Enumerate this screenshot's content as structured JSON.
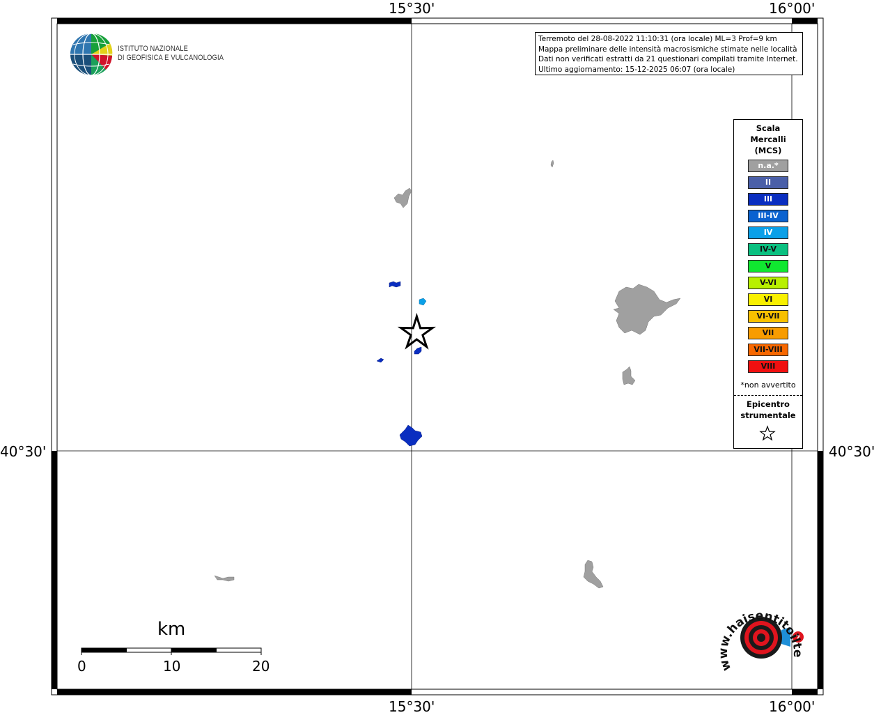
{
  "axes": {
    "top_labels": [
      "15°30'",
      "16°00'"
    ],
    "bottom_labels": [
      "15°30'",
      "16°00'"
    ],
    "left_labels": [
      "40°30'"
    ],
    "right_labels": [
      "40°30'"
    ]
  },
  "logo": {
    "line1": "ISTITUTO NAZIONALE",
    "line2": "DI GEOFISICA E VULCANOLOGIA",
    "icon": "globe-icon"
  },
  "info": {
    "line1": "Terremoto del 28-08-2022 11:10:31 (ora locale) ML=3 Prof=9 km",
    "line2": "Mappa preliminare delle intensità macrosismiche stimate nelle località",
    "line3": "Dati non verificati estratti da 21 questionari compilati tramite Internet.",
    "line4": "Ultimo aggiornamento: 15-12-2025 06:07 (ora locale)"
  },
  "legend": {
    "title_line1": "Scala",
    "title_line2": "Mercalli",
    "title_line3": "(MCS)",
    "items": [
      {
        "label": "n.a.*",
        "color": "#a0a0a0"
      },
      {
        "label": "II",
        "color": "#4a5fa8"
      },
      {
        "label": "III",
        "color": "#0a2ec0"
      },
      {
        "label": "III-IV",
        "color": "#0a62d0"
      },
      {
        "label": "IV",
        "color": "#0aa0e8"
      },
      {
        "label": "IV-V",
        "color": "#0ac080"
      },
      {
        "label": "V",
        "color": "#10e830"
      },
      {
        "label": "V-VI",
        "color": "#b8f000"
      },
      {
        "label": "VI",
        "color": "#f8f000"
      },
      {
        "label": "VI-VII",
        "color": "#f8c000"
      },
      {
        "label": "VII",
        "color": "#f89c00"
      },
      {
        "label": "VII-VIII",
        "color": "#f86800"
      },
      {
        "label": "VIII",
        "color": "#f01010"
      }
    ],
    "note": "*non avvertito",
    "epicenter_line1": "Epicentro",
    "epicenter_line2": "strumentale",
    "epicenter_icon": "star-icon"
  },
  "scale_bar": {
    "unit": "km",
    "ticks": [
      "0",
      "10",
      "20"
    ]
  },
  "branding": {
    "text": "www.haisentitoilterremoto.it",
    "icon": "seismic-target-icon",
    "accent": "#e0141e"
  },
  "localities": [
    {
      "name": "",
      "intensity": "n.a.*"
    },
    {
      "name": "",
      "intensity": "n.a.*"
    },
    {
      "name": "",
      "intensity": "n.a.*"
    },
    {
      "name": "",
      "intensity": "n.a.*"
    },
    {
      "name": "",
      "intensity": "III"
    },
    {
      "name": "",
      "intensity": "III"
    },
    {
      "name": "",
      "intensity": "IV"
    }
  ]
}
